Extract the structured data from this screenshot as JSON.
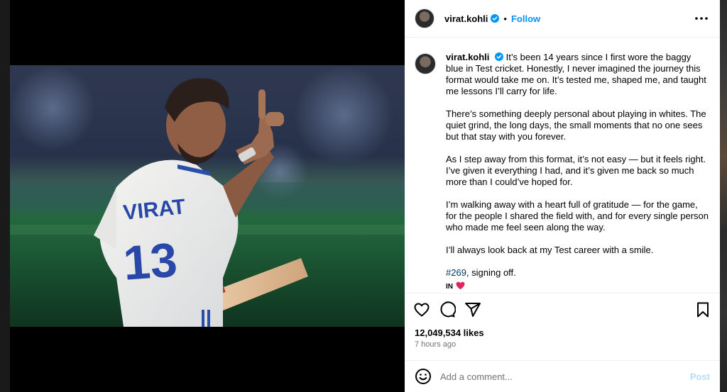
{
  "post": {
    "username": "virat.kohli",
    "follow_label": "Follow",
    "separator": "•",
    "caption_paragraphs": [
      "There’s something deeply personal about playing in whites. The quiet grind, the long days, the small moments that no one sees but that stay with you forever.",
      "As I step away from this format, it’s not easy — but it feels right. I’ve given it everything I had, and it’s given me back so much more than I could’ve hoped for.",
      "I’m walking away with a heart full of gratitude — for the game, for the people I shared the field with, and for every single person who made me feel seen along the way.",
      "I’ll always look back at my Test career with a smile."
    ],
    "caption_first": "It’s been 14 years since I first wore the baggy blue in Test cricket. Honestly, I never imagined the journey this format would take me on. It’s tested me, shaped me, and taught me lessons I’ll carry for life.",
    "hashtag": "#269",
    "hashtag_suffix": ", signing off.",
    "lang_tag": "IN",
    "likes": "12,049,534 likes",
    "timestamp": "7 hours ago",
    "comment_placeholder": "Add a comment...",
    "post_label": "Post",
    "jersey_name": "VIRAT",
    "jersey_number": "13"
  },
  "colors": {
    "accent": "#0095f6",
    "heart": "#e0245e",
    "post_disabled": "#b2dffc"
  },
  "icons": {
    "verified": "verified-badge-icon",
    "more": "more-horizontal-icon",
    "like": "heart-outline-icon",
    "comment": "comment-bubble-icon",
    "share": "paper-plane-icon",
    "save": "bookmark-icon",
    "emoji": "smiley-icon"
  }
}
